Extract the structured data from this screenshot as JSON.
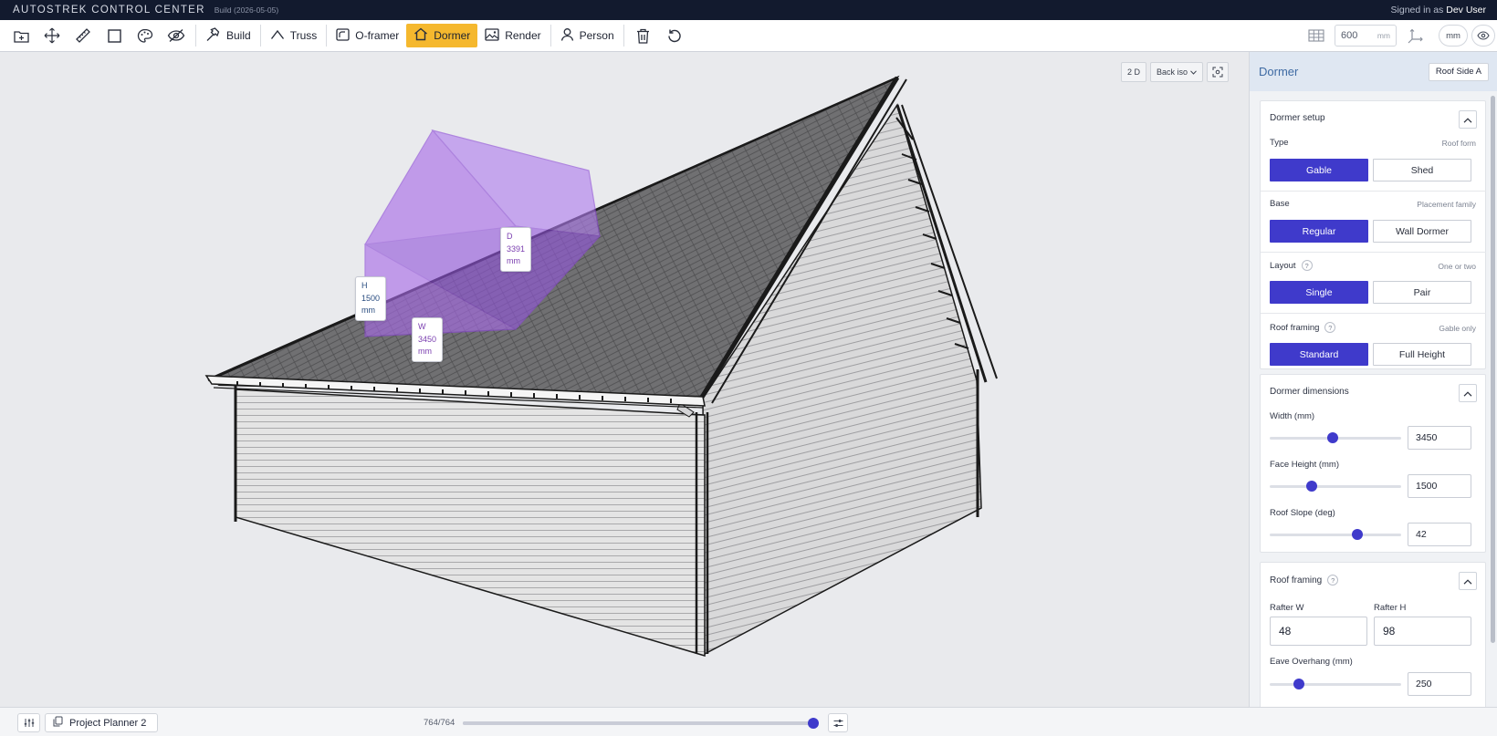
{
  "app": {
    "title": "AUTOSTREK CONTROL CENTER",
    "build": "Build (2026-05-05)",
    "signed_in_prefix": "Signed in as",
    "user": "Dev User"
  },
  "toolbar": {
    "icons": [
      "new-file-icon",
      "move-icon",
      "ruler-icon",
      "square-icon",
      "palette-icon",
      "hide-icon"
    ],
    "tools": [
      {
        "label": "Build",
        "icon": "hammer-icon"
      },
      {
        "label": "Truss",
        "icon": "truss-icon"
      },
      {
        "label": "O-framer",
        "icon": "frame-icon"
      },
      {
        "label": "Dormer",
        "icon": "house-icon",
        "active": true
      },
      {
        "label": "Render",
        "icon": "image-icon"
      },
      {
        "label": "Person",
        "icon": "person-icon"
      }
    ],
    "grid_size": "600",
    "grid_unit": "mm",
    "units": "mm"
  },
  "viewport": {
    "mode_2d": "2 D",
    "view_preset": "Back iso",
    "dims": {
      "h": {
        "letter": "H",
        "value": "1500",
        "unit": "mm"
      },
      "w": {
        "letter": "W",
        "value": "3450",
        "unit": "mm"
      },
      "d": {
        "letter": "D",
        "value": "3391",
        "unit": "mm"
      }
    }
  },
  "bottom": {
    "project": "Project Planner 2",
    "frame_count": "764/764",
    "progress": 1.0
  },
  "panel": {
    "title": "Dormer",
    "side_button": "Roof Side A",
    "setup": {
      "title": "Dormer setup",
      "type": {
        "label": "Type",
        "hint": "Roof form",
        "options": [
          "Gable",
          "Shed"
        ],
        "selected": 0
      },
      "base": {
        "label": "Base",
        "hint": "Placement family",
        "options": [
          "Regular",
          "Wall Dormer"
        ],
        "selected": 0
      },
      "layout": {
        "label": "Layout",
        "hint": "One or two",
        "options": [
          "Single",
          "Pair"
        ],
        "selected": 0
      },
      "framing": {
        "label": "Roof framing",
        "hint": "Gable only",
        "options": [
          "Standard",
          "Full Height"
        ],
        "selected": 0
      }
    },
    "dimensions": {
      "title": "Dormer dimensions",
      "width": {
        "label": "Width (mm)",
        "value": "3450",
        "fraction": 0.48
      },
      "face_height": {
        "label": "Face Height (mm)",
        "value": "1500",
        "fraction": 0.32
      },
      "roof_slope": {
        "label": "Roof Slope (deg)",
        "value": "42",
        "fraction": 0.67
      }
    },
    "roof_framing": {
      "title": "Roof framing",
      "rafter_w": {
        "label": "Rafter W",
        "value": "48"
      },
      "rafter_h": {
        "label": "Rafter H",
        "value": "98"
      },
      "eave": {
        "label": "Eave Overhang (mm)",
        "value": "250",
        "fraction": 0.22
      }
    }
  },
  "colors": {
    "accent": "#3f3acb",
    "active_tool": "#f5b82e",
    "topbar": "#121a2e",
    "dormer": "#9a55e0",
    "roof": "#6b6b6d"
  }
}
